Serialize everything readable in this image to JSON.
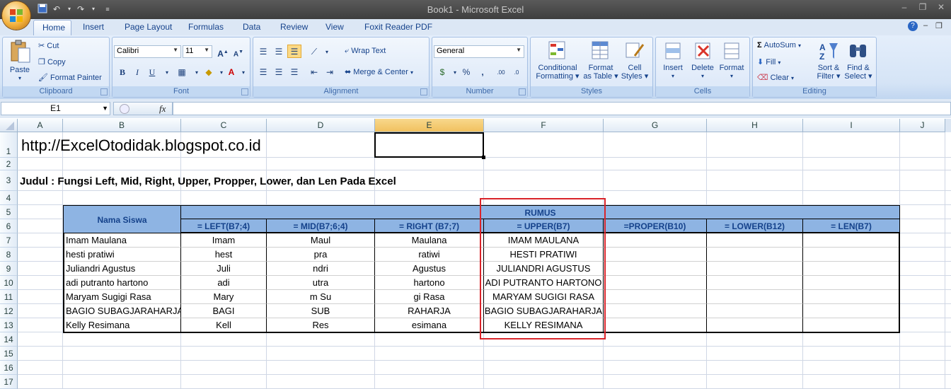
{
  "window": {
    "title": "Book1 - Microsoft Excel"
  },
  "tabs": [
    "Home",
    "Insert",
    "Page Layout",
    "Formulas",
    "Data",
    "Review",
    "View",
    "Foxit Reader PDF"
  ],
  "ribbon": {
    "clipboard": {
      "label": "Clipboard",
      "paste": "Paste",
      "cut": "Cut",
      "copy": "Copy",
      "format_painter": "Format Painter"
    },
    "font": {
      "label": "Font",
      "name": "Calibri",
      "size": "11"
    },
    "alignment": {
      "label": "Alignment",
      "wrap_text": "Wrap Text",
      "merge_center": "Merge & Center"
    },
    "number": {
      "label": "Number",
      "format": "General"
    },
    "styles": {
      "label": "Styles",
      "conditional": [
        "Conditional",
        "Formatting"
      ],
      "format_table": [
        "Format",
        "as Table"
      ],
      "cell_styles": [
        "Cell",
        "Styles"
      ]
    },
    "cells": {
      "label": "Cells",
      "insert": "Insert",
      "delete": "Delete",
      "format": "Format"
    },
    "editing": {
      "label": "Editing",
      "autosum": "AutoSum",
      "fill": "Fill",
      "clear": "Clear",
      "sort": [
        "Sort &",
        "Filter"
      ],
      "find": [
        "Find &",
        "Select"
      ]
    }
  },
  "formula_bar": {
    "name_box": "E1",
    "fx": "fx",
    "value": ""
  },
  "columns": [
    "A",
    "B",
    "C",
    "D",
    "E",
    "F",
    "G",
    "H",
    "I",
    "J"
  ],
  "rows": [
    "1",
    "2",
    "3",
    "4",
    "5",
    "6",
    "7",
    "8",
    "9",
    "10",
    "11",
    "12",
    "13",
    "14",
    "15",
    "16",
    "17"
  ],
  "sheet": {
    "url": "http://ExcelOtodidak.blogspot.co.id",
    "judul": "Judul : Fungsi Left, Mid, Right, Upper, Propper, Lower, dan Len Pada Excel",
    "header_name": "Nama Siswa",
    "header_rumus": "RUMUS",
    "formula_headers": [
      "= LEFT(B7;4)",
      "= MID(B7;6;4)",
      "= RIGHT (B7;7)",
      "= UPPER(B7)",
      "=PROPER(B10)",
      "= LOWER(B12)",
      "= LEN(B7)"
    ],
    "data_rows": [
      [
        "Imam Maulana",
        "Imam",
        "Maul",
        "Maulana",
        "IMAM MAULANA"
      ],
      [
        "hesti pratiwi",
        "hest",
        "pra",
        "ratiwi",
        "HESTI PRATIWI"
      ],
      [
        "Juliandri Agustus",
        "Juli",
        "ndri",
        "Agustus",
        "JULIANDRI AGUSTUS"
      ],
      [
        "adi putranto hartono",
        "adi",
        "utra",
        "hartono",
        "ADI PUTRANTO HARTONO"
      ],
      [
        "Maryam Sugigi Rasa",
        "Mary",
        "m Su",
        "gi Rasa",
        "MARYAM SUGIGI RASA"
      ],
      [
        "BAGIO SUBAGJARAHARJA",
        "BAGI",
        "SUB",
        "RAHARJA",
        "BAGIO SUBAGJARAHARJA"
      ],
      [
        "Kelly Resimana",
        "Kell",
        "Res",
        "esimana",
        "KELLY RESIMANA"
      ]
    ]
  },
  "colors": {
    "header_fill": "#8eb4e3",
    "highlight_box": "#d9242a",
    "selected_col": "#f1c15f"
  }
}
